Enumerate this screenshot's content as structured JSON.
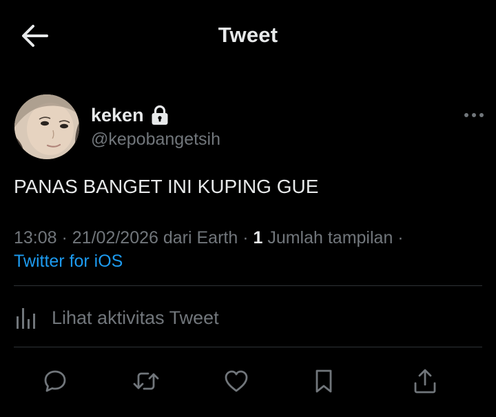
{
  "header": {
    "title": "Tweet",
    "back_icon": "arrow-left-icon"
  },
  "author": {
    "name": "keken",
    "handle": "@kepobangetsih",
    "protected_icon": "lock-icon",
    "avatar": "profile-photo"
  },
  "tweet": {
    "text": "PANAS BANGET INI KUPING GUE",
    "time": "13:08",
    "sep1": " · ",
    "date": "21/02/2026",
    "location": " dari Earth",
    "sep2": " · ",
    "views_count": "1",
    "views_label": " Jumlah tampilan",
    "sep3": " ·",
    "source": "Twitter for iOS"
  },
  "activity": {
    "label": "Lihat aktivitas Tweet",
    "icon": "analytics-icon"
  },
  "actions": {
    "reply": "reply-icon",
    "retweet": "retweet-icon",
    "like": "heart-icon",
    "bookmark": "bookmark-icon",
    "share": "share-icon"
  },
  "colors": {
    "background": "#000000",
    "text": "#e7e9ea",
    "secondary": "#71767b",
    "link": "#1d9bf0",
    "divider": "#2f3336"
  }
}
